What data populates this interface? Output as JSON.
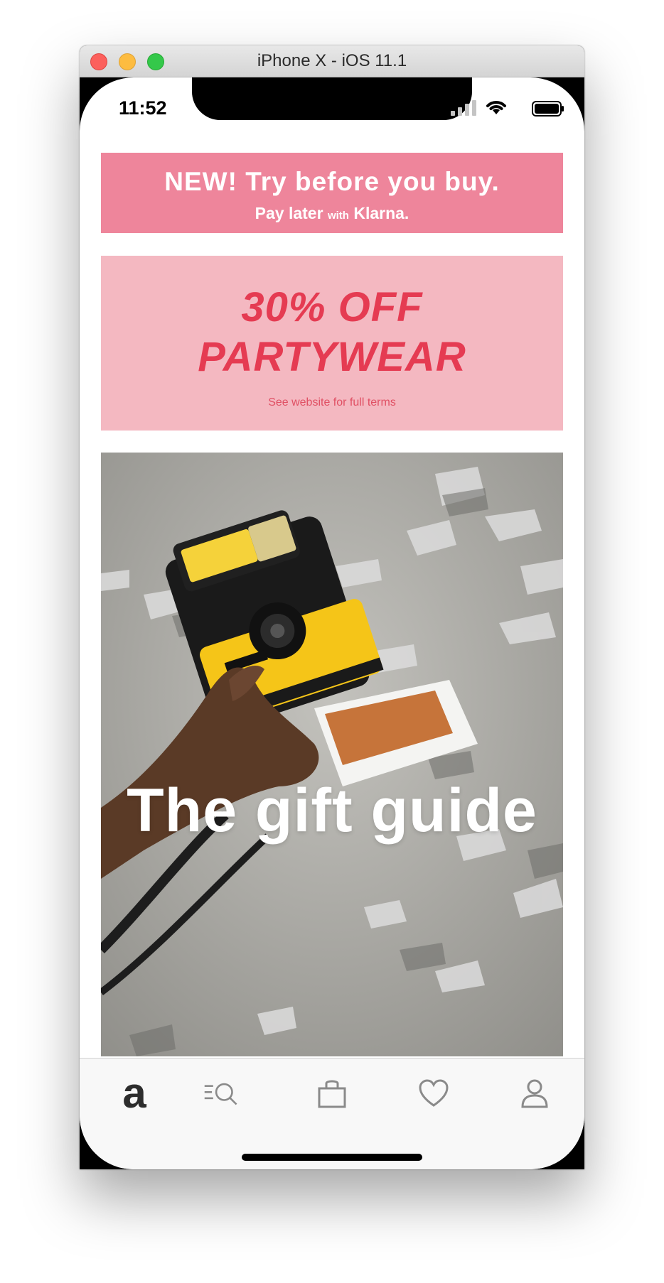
{
  "window": {
    "title": "iPhone X - iOS 11.1"
  },
  "status_bar": {
    "time": "11:52"
  },
  "banners": {
    "klarna": {
      "headline": "NEW! Try before you buy.",
      "sub_prefix": "Pay later",
      "sub_small": "with",
      "sub_brand": "Klarna."
    },
    "sale": {
      "line1": "30% OFF",
      "line2": "PARTYWEAR",
      "terms": "See website for full terms"
    }
  },
  "hero": {
    "title": "The gift guide"
  },
  "tabbar": {
    "home_logo": "a",
    "icons": [
      "home-icon",
      "search-list-icon",
      "bag-icon",
      "heart-icon",
      "account-icon"
    ]
  },
  "colors": {
    "klarna_bg": "#ee859b",
    "sale_bg": "#f4b8c1",
    "sale_text": "#e53b52",
    "hero_bg": "#a9a8a3",
    "tab_icon": "#8a8a8a"
  }
}
